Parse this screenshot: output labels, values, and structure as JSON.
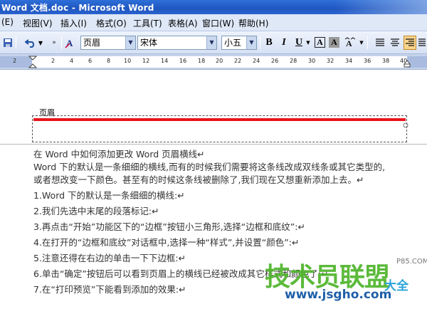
{
  "window": {
    "title": "Word 文档.doc - Microsoft Word"
  },
  "menu": [
    "(E)",
    "视图(V)",
    "插入(I)",
    "格式(O)",
    "工具(T)",
    "表格(A)",
    "窗口(W)",
    "帮助(H)"
  ],
  "toolbar": {
    "style_value": "页眉",
    "font_value": "宋体",
    "size_value": "小五",
    "bold_label": "B",
    "italic_label": "I",
    "underline_label": "U",
    "charborder_label": "A",
    "charshade_label": "A"
  },
  "ruler": {
    "numbers": [
      "2",
      "2",
      "4",
      "6",
      "8",
      "10",
      "12",
      "14",
      "16",
      "18",
      "20",
      "22",
      "24",
      "26",
      "28",
      "30",
      "32",
      "34",
      "36",
      "38",
      "40"
    ]
  },
  "document": {
    "header_label": "页眉",
    "lines": [
      "在 Word 中如何添加更改 Word 页眉横线↵",
      "Word 下的默认是一条细细的横线,而有的时候我们需要将这条线改成双线条或其它类型的,",
      "或者想改变一下颜色。甚至有的时候这条线被删除了,我们现在又想重新添加上去。↵",
      "1.Word 下的默认是一条细细的横线:↵",
      "2.我们先选中末尾的段落标记:↵",
      "3.再点击“开始”功能区下的“边框”按钮小三角形,选择“边框和底纹”:↵",
      "4.在打开的“边框和底纹”对话框中,选择一种“样式”,并设置“颜色”:↵",
      "5.注意还得在右边的单击一下下边框:↵",
      "6.单击“确定”按钮后可以看到页眉上的横线已经被改成其它样式和颜色了:↵",
      "7.在“打印预览”下能看到添加的效果:↵"
    ]
  },
  "watermark": {
    "brand": "技术员联盟",
    "suffix": "大全",
    "url": "www.jsgho.com",
    "tag": "P85.COM"
  },
  "colors": {
    "titlebar": "#1f56c0",
    "header_rule": "#e8141c",
    "watermark_green": "#4fb52b"
  }
}
